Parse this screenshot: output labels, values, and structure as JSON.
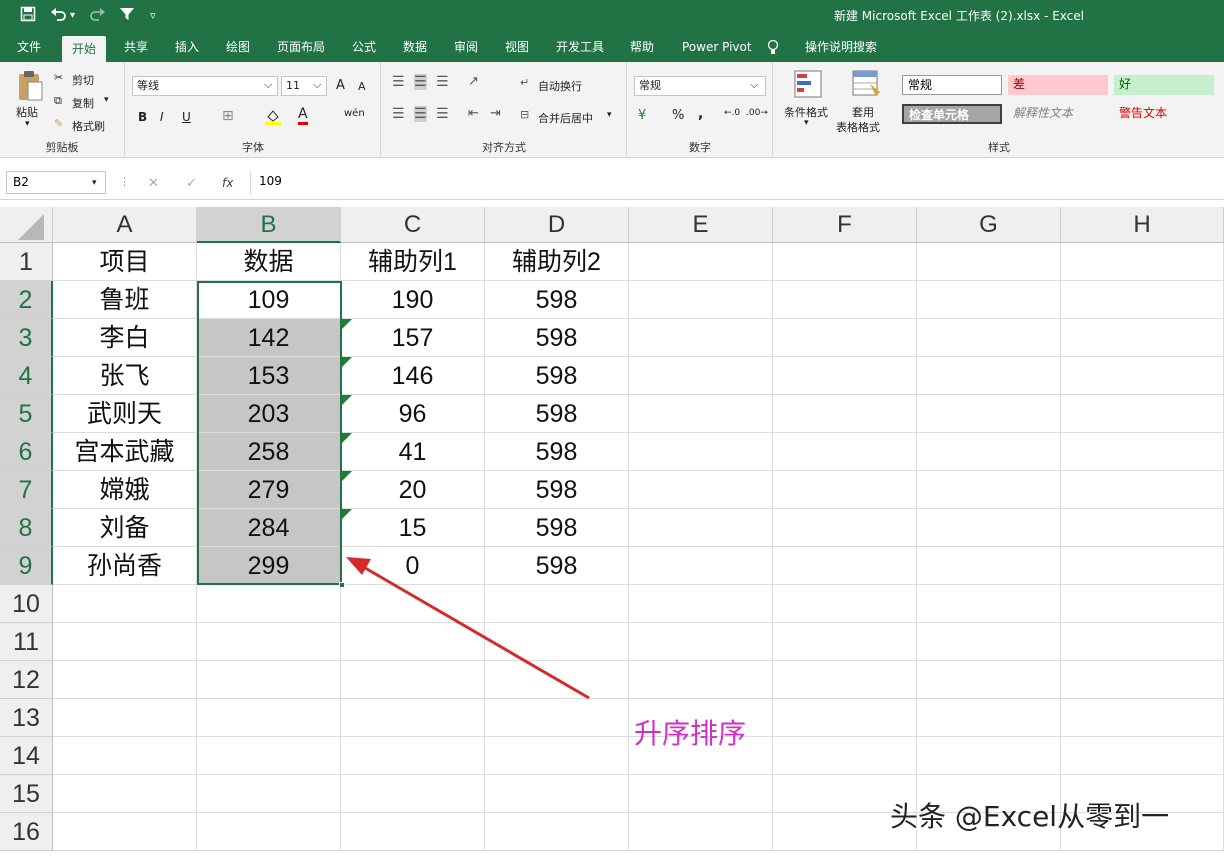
{
  "window": {
    "title": "新建 Microsoft Excel 工作表 (2).xlsx  -  Excel"
  },
  "quick_access": {
    "save_icon": "save-icon",
    "undo_icon": "undo-icon",
    "redo_icon": "redo-icon",
    "filter_icon": "filter-icon",
    "customize_icon": "customize-icon"
  },
  "tabs": [
    "文件",
    "开始",
    "共享",
    "插入",
    "绘图",
    "页面布局",
    "公式",
    "数据",
    "审阅",
    "视图",
    "开发工具",
    "帮助",
    "Power Pivot",
    "操作说明搜索"
  ],
  "active_tab": "开始",
  "ribbon": {
    "clipboard": {
      "paste": "粘贴",
      "cut": "剪切",
      "copy": "复制",
      "format_painter": "格式刷",
      "label": "剪贴板"
    },
    "font": {
      "name": "等线",
      "size": "11",
      "bold": "B",
      "italic": "I",
      "underline": "U",
      "grow": "A",
      "shrink": "A",
      "color_a": "A",
      "wen": "wén",
      "label": "字体"
    },
    "alignment": {
      "wrap": "自动换行",
      "merge": "合并后居中",
      "label": "对齐方式"
    },
    "number": {
      "format": "常规",
      "percent": "%",
      "comma": ",",
      "label": "数字"
    },
    "styles": {
      "cond_format": "条件格式",
      "table_format_1": "套用",
      "table_format_2": "表格格式",
      "normal": "常规",
      "bad": "差",
      "good": "好",
      "check_cell": "检查单元格",
      "explanatory": "解释性文本",
      "warning": "警告文本",
      "label": "样式"
    }
  },
  "formula_bar": {
    "name_box": "B2",
    "cancel": "✕",
    "enter": "✓",
    "fx": "fx",
    "value": "109"
  },
  "columns": [
    "A",
    "B",
    "C",
    "D",
    "E",
    "F",
    "G",
    "H"
  ],
  "rows": [
    "1",
    "2",
    "3",
    "4",
    "5",
    "6",
    "7",
    "8",
    "9",
    "10",
    "11",
    "12",
    "13",
    "14",
    "15",
    "16"
  ],
  "table": [
    [
      "项目",
      "数据",
      "辅助列1",
      "辅助列2"
    ],
    [
      "鲁班",
      "109",
      "190",
      "598"
    ],
    [
      "李白",
      "142",
      "157",
      "598"
    ],
    [
      "张飞",
      "153",
      "146",
      "598"
    ],
    [
      "武则天",
      "203",
      "96",
      "598"
    ],
    [
      "宫本武藏",
      "258",
      "41",
      "598"
    ],
    [
      "嫦娥",
      "279",
      "20",
      "598"
    ],
    [
      "刘备",
      "284",
      "15",
      "598"
    ],
    [
      "孙尚香",
      "299",
      "0",
      "598"
    ]
  ],
  "annotation": {
    "text": "升序排序",
    "color": "#d12fc6",
    "arrow_color": "#d42a2a"
  },
  "watermark": "头条 @Excel从零到一",
  "colors": {
    "excel_green": "#217346",
    "selection_fill": "#c6c6c6"
  }
}
